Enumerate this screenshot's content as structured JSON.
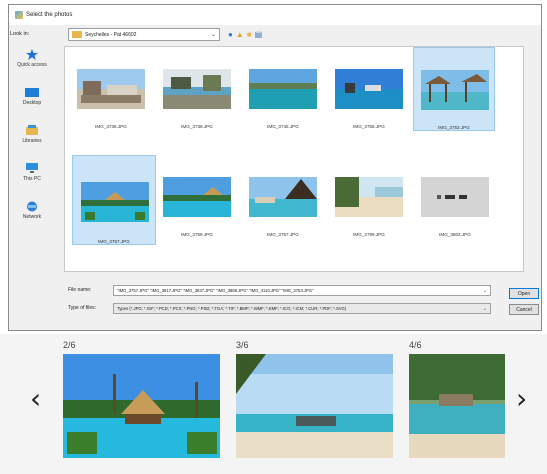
{
  "dialog": {
    "title": "Select the photos",
    "look_in_label": "Look in:",
    "look_in_value": "Seychelles - Pat 46602",
    "places": [
      {
        "label": "Quick access",
        "icon": "star-icon"
      },
      {
        "label": "Desktop",
        "icon": "desktop-icon"
      },
      {
        "label": "Libraries",
        "icon": "libraries-icon"
      },
      {
        "label": "This PC",
        "icon": "computer-icon"
      },
      {
        "label": "Network",
        "icon": "network-icon"
      }
    ],
    "files": [
      {
        "name": "IMG_3736.JPG",
        "selected": false
      },
      {
        "name": "IMG_3738.JPG",
        "selected": false
      },
      {
        "name": "IMG_3745.JPG",
        "selected": false
      },
      {
        "name": "IMG_3755.JPG",
        "selected": false
      },
      {
        "name": "IMG_3753.JPG",
        "selected": true
      },
      {
        "name": "IMG_3757.JPG",
        "selected": true
      },
      {
        "name": "IMG_3759.JPG",
        "selected": false
      },
      {
        "name": "IMG_3767.JPG",
        "selected": false
      },
      {
        "name": "IMG_3799.JPG",
        "selected": false
      },
      {
        "name": "IMG_3802.JPG",
        "selected": false
      }
    ],
    "file_name_label": "File name:",
    "file_name_value": "\"IMG_3757.JPG\" \"IMG_3817.JPG\" \"IMG_3837.JPG\" \"IMG_3869.JPG\" \"IMG_4110.JPG\" \"IMG_3753.JPG\"",
    "file_type_label": "Type of files:",
    "file_type_value": "Types (*.JPG; *.GIF; *.PCD; *.PCX; *.PNG; *.PSD; *.TGA; *.TIF; *.BMP; *.WMF; *.EMF; *.ICO; *.ICM; *.CUR; *.PDF; *.SVG)",
    "open_label": "Open",
    "cancel_label": "Cancel"
  },
  "preview": {
    "prev_icon": "chevron-left-icon",
    "next_icon": "chevron-right-icon",
    "items": [
      {
        "counter": "2/6"
      },
      {
        "counter": "3/6"
      },
      {
        "counter": "4/6"
      }
    ]
  }
}
